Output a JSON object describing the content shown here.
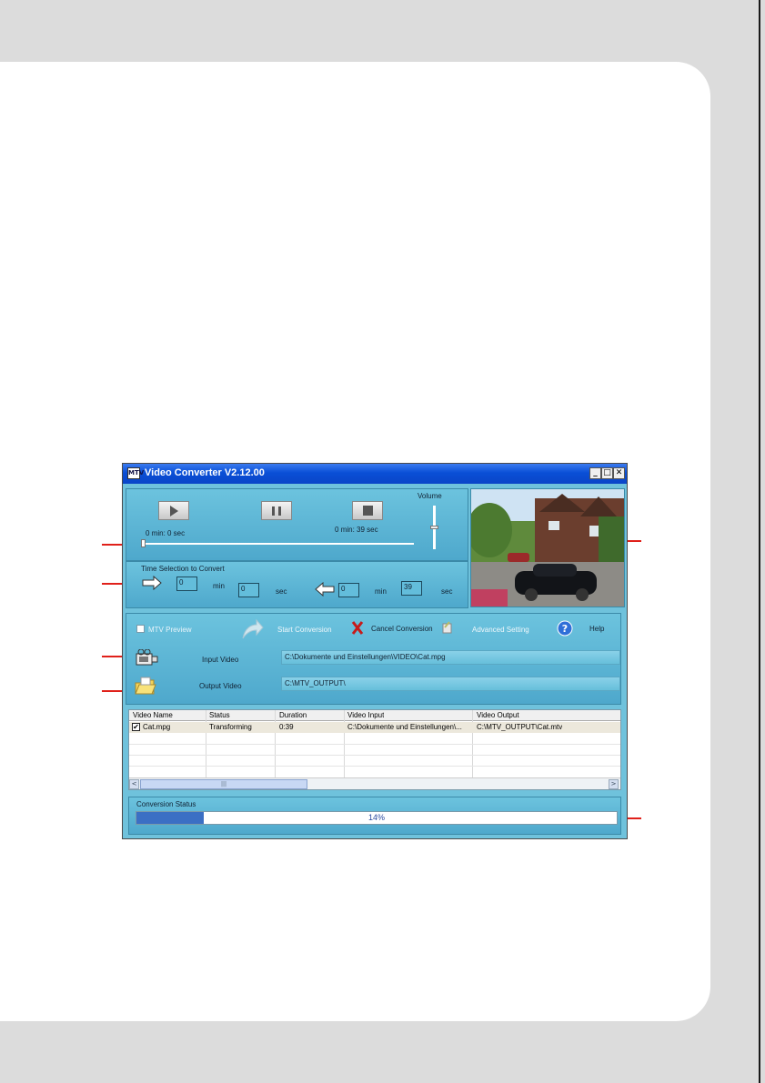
{
  "window": {
    "title": "Video Converter V2.12.00",
    "app_icon_text": "MTV",
    "minimize": "_",
    "maximize": "□",
    "close": "✕"
  },
  "player": {
    "current_time": "0 min: 0 sec",
    "total_time": "0 min: 39 sec",
    "volume_label": "Volume",
    "position_fraction": 0
  },
  "time_selection": {
    "label": "Time Selection to Convert",
    "start_min": "0",
    "start_sec": "0",
    "end_min": "0",
    "end_sec": "39",
    "min_label": "min",
    "sec_label": "sec"
  },
  "toolbar": {
    "preview_label": "MTV Preview",
    "preview_checked": false,
    "start_label": "Start Conversion",
    "cancel_label": "Cancel Conversion",
    "advanced_label": "Advanced Setting",
    "help_label": "Help"
  },
  "input_video": {
    "label": "Input Video",
    "path": "C:\\Dokumente und Einstellungen\\VIDEO\\Cat.mpg"
  },
  "output_video": {
    "label": "Output Video",
    "path": "C:\\MTV_OUTPUT\\"
  },
  "table": {
    "columns": [
      "Video Name",
      "Status",
      "Duration",
      "Video Input",
      "Video Output"
    ],
    "rows": [
      {
        "name": "Cat.mpg",
        "status": "Transforming",
        "duration": "0:39",
        "input": "C:\\Dokumente und Einstellungen\\...",
        "output": "C:\\MTV_OUTPUT\\Cat.mtv",
        "checked": true
      }
    ],
    "scroll_left": "<",
    "scroll_right": ">",
    "scroll_grip": "|||"
  },
  "conversion": {
    "label": "Conversion Status",
    "percent_text": "14%",
    "progress_fraction": 0.14
  },
  "colors": {
    "titlebar": "#0a4fd6",
    "panel": "#6fc2dc",
    "progress": "#3b6fc4",
    "callout_arrow": "#e0201a"
  }
}
